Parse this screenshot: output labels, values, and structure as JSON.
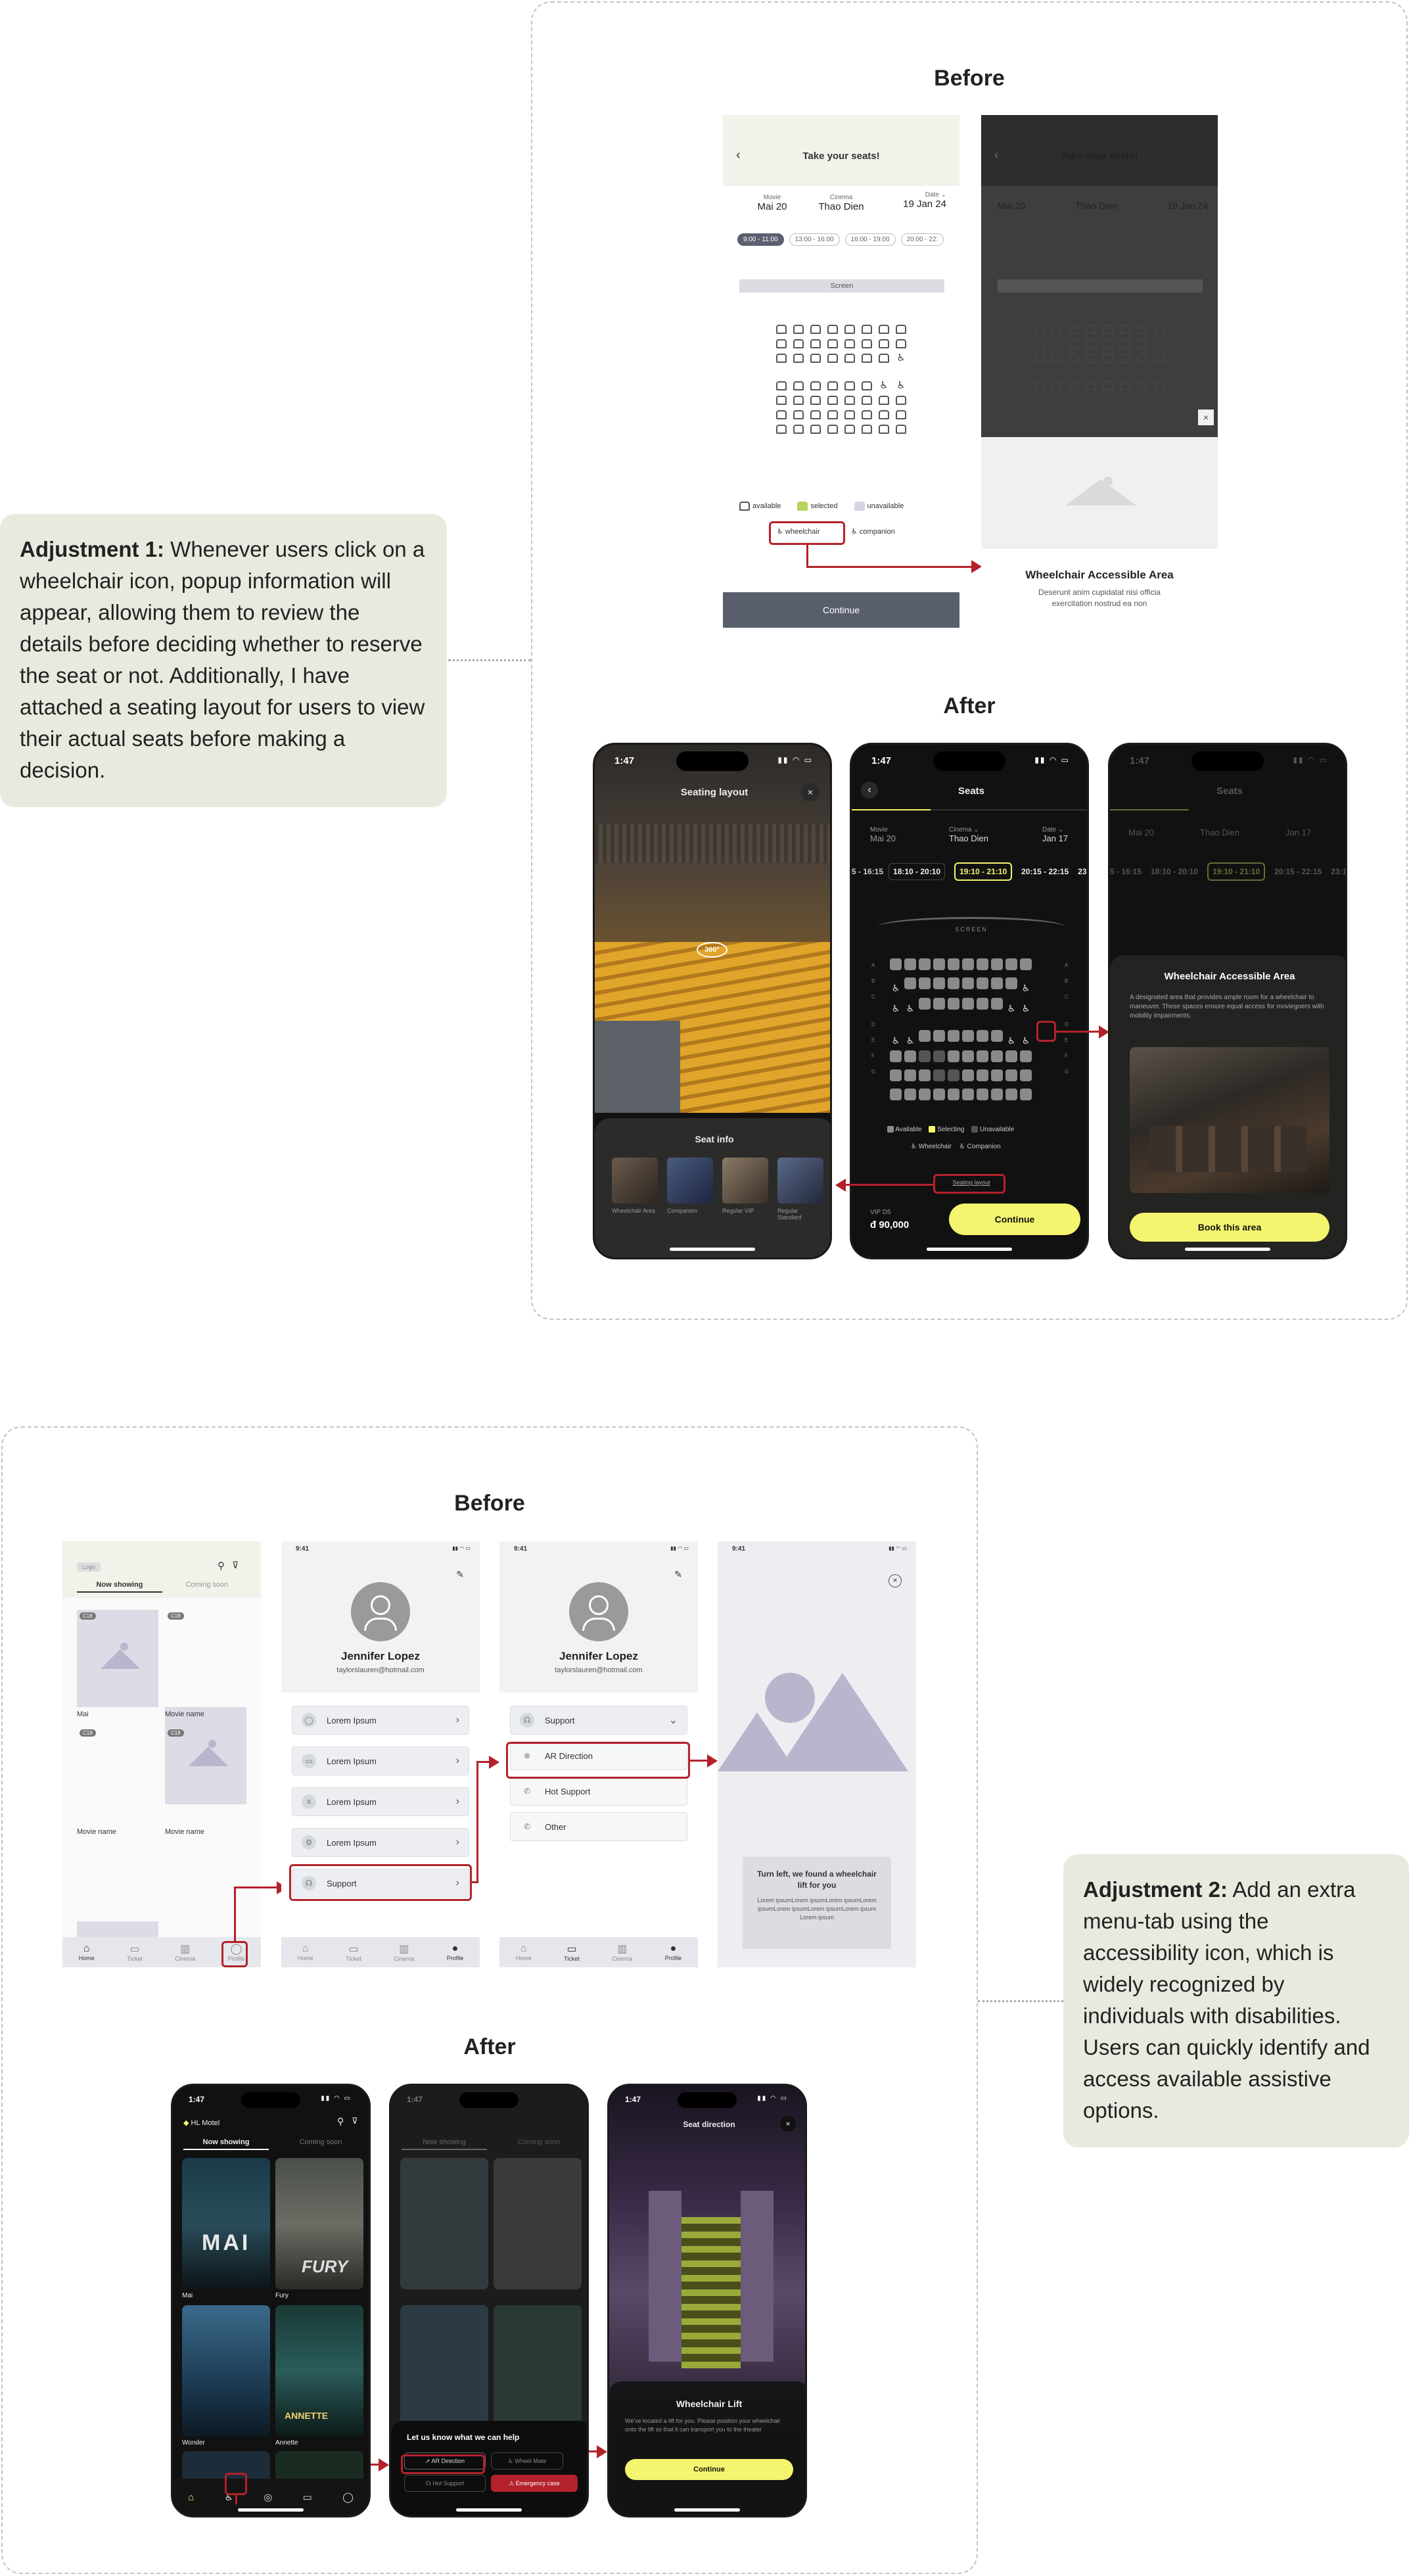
{
  "section1": {
    "before_title": "Before",
    "after_title": "After",
    "note_bold": "Adjustment 1:",
    "note_text": " Whenever users click on a wheelchair icon, popup information will appear, allowing them to review the details before deciding whether to reserve the seat or not. Additionally, I have attached a seating layout for users to view their actual seats before making a decision.",
    "before_screen": {
      "title": "Take your seats!",
      "movie_label": "Movie",
      "movie": "Mai 20",
      "cinema_label": "Cinema",
      "cinema": "Thao Dien",
      "date_label": "Date",
      "date": "19 Jan 24",
      "times": [
        "9:00 - 11:00",
        "13:00 - 16:00",
        "16:00 - 19:00",
        "20:00 - 22:"
      ],
      "screen": "Screen",
      "legend": {
        "available": "available",
        "selected": "selected",
        "unavailable": "unavailable",
        "wheelchair": "wheelchair",
        "companion": "companion"
      },
      "continue": "Continue"
    },
    "before_popup": {
      "title": "Wheelchair Accessible Area",
      "desc": "Deserunt anim cupidatat nisi officia exercitation nostrud ea non"
    },
    "after_layout": {
      "title": "Seating layout",
      "badge": "360°",
      "info_title": "Seat info",
      "cards": [
        "Wheelchair Area",
        "Companion",
        "Regular VIP",
        "Regular Standard"
      ]
    },
    "after_seats": {
      "time": "1:47",
      "title": "Seats",
      "movie_label": "Movie",
      "movie": "Mai 20",
      "cinema_label": "Cinema",
      "cinema": "Thao Dien",
      "date_label": "Date",
      "date": "Jan 17",
      "times": [
        "5 - 16:15",
        "18:10 - 20:10",
        "19:10 - 21:10",
        "20:15 - 22:15",
        "23:15"
      ],
      "screen": "SCREEN",
      "rows_left": [
        "A",
        "B",
        "C",
        "D",
        "E",
        "F",
        "G"
      ],
      "legend": {
        "available": "Available",
        "selecting": "Selecting",
        "unavailable": "Unavailable",
        "wheelchair": "Wheelchair",
        "companion": "Companion"
      },
      "seating_layout": "Seating layout",
      "seat_code": "VIP D5",
      "price": "đ 90,000",
      "continue": "Continue"
    },
    "after_popup": {
      "title": "Wheelchair Accessible Area",
      "desc": "A designated area that provides ample room for a wheelchair to maneuver. These spaces ensure equal access for moviegoers with mobility impairments.",
      "button": "Book this area"
    }
  },
  "section2": {
    "before_title": "Before",
    "after_title": "After",
    "note_bold": "Adjustment 2:",
    "note_text": " Add an extra menu-tab using the accessibility icon, which is widely recognized by individuals with disabilities. Users can quickly identify and access available assistive options.",
    "home_before": {
      "logo": "Logo",
      "tabs": [
        "Now showing",
        "Coming soon"
      ],
      "items": [
        "Mai",
        "Movie name",
        "Movie name",
        "Movie name",
        "",
        ""
      ],
      "badge": "C18",
      "nav": [
        "Home",
        "Ticket",
        "Cinema",
        "Profile"
      ]
    },
    "profile": {
      "time": "9:41",
      "name": "Jennifer Lopez",
      "email": "taylorslauren@hotmail.com",
      "items": [
        "Lorem Ipsum",
        "Lorem Ipsum",
        "Lorem Ipsum",
        "Lorem Ipsum",
        "Support"
      ],
      "nav": [
        "Home",
        "Ticket",
        "Cinema",
        "Profile"
      ]
    },
    "support": {
      "time": "9:41",
      "name": "Jennifer Lopez",
      "email": "taylorslauren@hotmail.com",
      "head": "Support",
      "items": [
        "AR Direction",
        "Hot Support",
        "Other"
      ],
      "nav": [
        "Home",
        "Ticket",
        "Cinema",
        "Profile"
      ]
    },
    "ar_before": {
      "time": "9:41",
      "text": "Turn left, we found a wheelchair lift for you",
      "lorem": "Lorem ipsumLorem ipsumLorem ipsumLorem ipsumLorem ipsumLorem ipsumLorem ipsumLorem ipsum"
    },
    "home_after": {
      "time": "1:47",
      "location": "HL Motel",
      "tabs": [
        "Now showing",
        "Coming soon"
      ],
      "movies": [
        "Mai",
        "Fury",
        "Wonder",
        "Annette"
      ]
    },
    "help_after": {
      "time": "1:47",
      "title": "Let us know what we can help",
      "buttons": [
        "AR Direction",
        "Wheel Mate",
        "Hot Support",
        "Emergency case"
      ]
    },
    "lift_after": {
      "time": "1:47",
      "title": "Seat direction",
      "card_title": "Wheelchair Lift",
      "card_text": "We've located a lift for you. Please position your wheelchair onto the lift so that it can transport you to the theater",
      "button": "Continue"
    }
  }
}
